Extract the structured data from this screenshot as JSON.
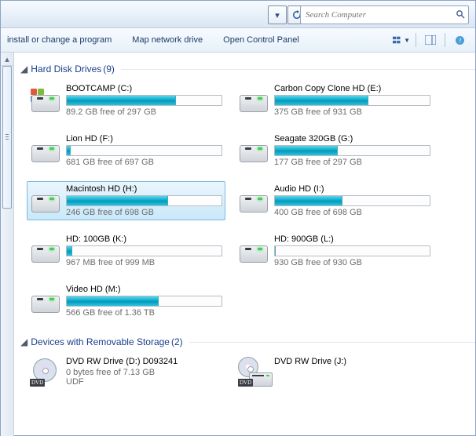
{
  "search": {
    "placeholder": "Search Computer"
  },
  "commands": {
    "install": "install or change a program",
    "mapdrive": "Map network drive",
    "cpanel": "Open Control Panel"
  },
  "groups": [
    {
      "name": "Hard Disk Drives",
      "count": "(9)",
      "items": [
        {
          "label": "BOOTCAMP (C:)",
          "free": "89.2 GB free of 297 GB",
          "used_pct": 70,
          "win": true
        },
        {
          "label": "Carbon Copy Clone HD (E:)",
          "free": "375 GB free of 931 GB",
          "used_pct": 60
        },
        {
          "label": "Lion HD (F:)",
          "free": "681 GB free of 697 GB",
          "used_pct": 2
        },
        {
          "label": "Seagate 320GB (G:)",
          "free": "177 GB free of 297 GB",
          "used_pct": 40
        },
        {
          "label": "Macintosh HD (H:)",
          "free": "246 GB free of 698 GB",
          "used_pct": 65,
          "selected": true
        },
        {
          "label": "Audio HD (I:)",
          "free": "400 GB free of 698 GB",
          "used_pct": 43
        },
        {
          "label": "HD: 100GB (K:)",
          "free": "967 MB free of 999 MB",
          "used_pct": 3
        },
        {
          "label": "HD: 900GB  (L:)",
          "free": "930 GB free of 930 GB",
          "used_pct": 0
        },
        {
          "label": "Video HD (M:)",
          "free": "566 GB free of 1.36 TB",
          "used_pct": 59
        }
      ]
    },
    {
      "name": "Devices with Removable Storage",
      "count": "(2)",
      "items": [
        {
          "label": "DVD RW Drive (D:) D093241",
          "free": "0 bytes free of 7.13 GB",
          "sub": "UDF",
          "icon": "dvd"
        },
        {
          "label": "DVD RW Drive (J:)",
          "icon": "dvd-drive"
        }
      ]
    }
  ]
}
